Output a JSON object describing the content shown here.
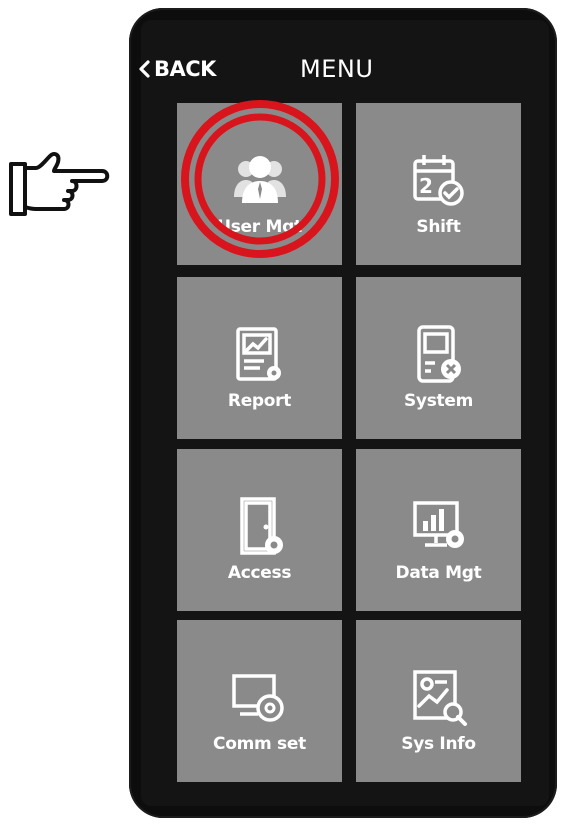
{
  "header": {
    "back_label": "BACK",
    "title": "MENU"
  },
  "menu": {
    "items": [
      {
        "label": "User Mgt",
        "icon": "users-icon",
        "highlighted": true
      },
      {
        "label": "Shift",
        "icon": "calendar-check-icon"
      },
      {
        "label": "Report",
        "icon": "report-chart-icon"
      },
      {
        "label": "System",
        "icon": "device-settings-icon"
      },
      {
        "label": "Access",
        "icon": "door-gear-icon"
      },
      {
        "label": "Data Mgt",
        "icon": "data-chart-gear-icon"
      },
      {
        "label": "Comm set",
        "icon": "monitor-gear-icon"
      },
      {
        "label": "Sys Info",
        "icon": "info-search-icon"
      }
    ]
  },
  "annotation": {
    "pointer_icon": "pointing-hand-icon",
    "highlight_color": "#d8141c"
  },
  "colors": {
    "tile": "#8a8a8a",
    "device": "#0d0d0d",
    "text": "#ffffff"
  }
}
